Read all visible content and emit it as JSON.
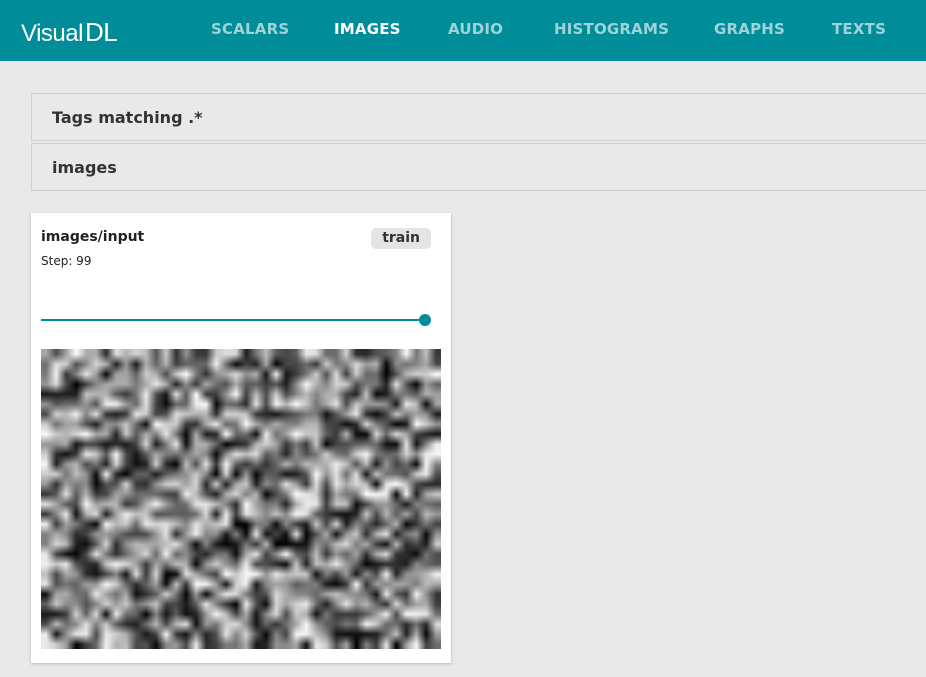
{
  "app": {
    "logo_visual": "Visual",
    "logo_dl": "DL",
    "accent_color": "#008c99"
  },
  "nav": {
    "items": [
      {
        "label": "SCALARS",
        "active": false
      },
      {
        "label": "IMAGES",
        "active": true
      },
      {
        "label": "AUDIO",
        "active": false
      },
      {
        "label": "HISTOGRAMS",
        "active": false
      },
      {
        "label": "GRAPHS",
        "active": false
      },
      {
        "label": "TEXTS",
        "active": false
      }
    ]
  },
  "filters": {
    "tags_matching_label": "Tags matching .*",
    "group_label": "images"
  },
  "image_card": {
    "title": "images/input",
    "run": "train",
    "step_label": "Step: 99",
    "step": 99,
    "step_max": 99,
    "image_icon": "random-noise-image"
  }
}
